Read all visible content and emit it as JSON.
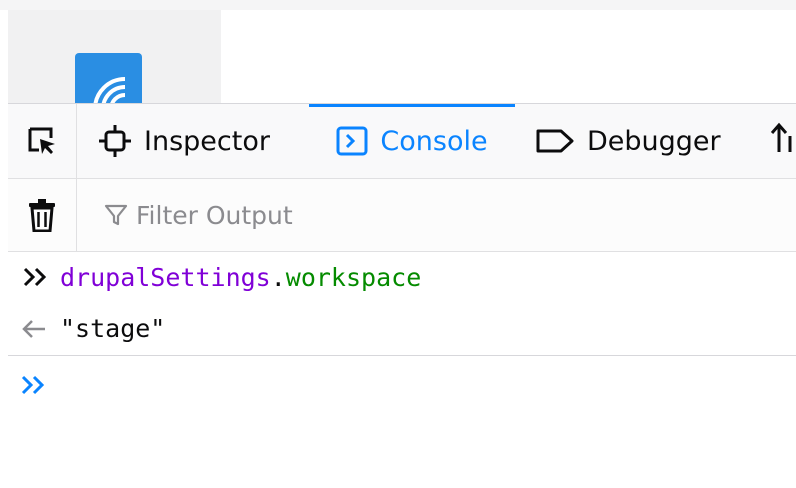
{
  "toolbox": {
    "tabs": [
      {
        "label": "Inspector",
        "icon": "inspector-icon"
      },
      {
        "label": "Console",
        "icon": "console-icon",
        "selected": true
      },
      {
        "label": "Debugger",
        "icon": "debugger-icon"
      }
    ]
  },
  "filter": {
    "placeholder": "Filter Output"
  },
  "console": {
    "input": {
      "variable": "drupalSettings",
      "dot": ".",
      "property": "workspace"
    },
    "result": "\"stage\""
  },
  "colors": {
    "accent": "#0a84ff",
    "variable": "#8000d7",
    "property": "#058b00",
    "logo": "#2a8ee3"
  }
}
